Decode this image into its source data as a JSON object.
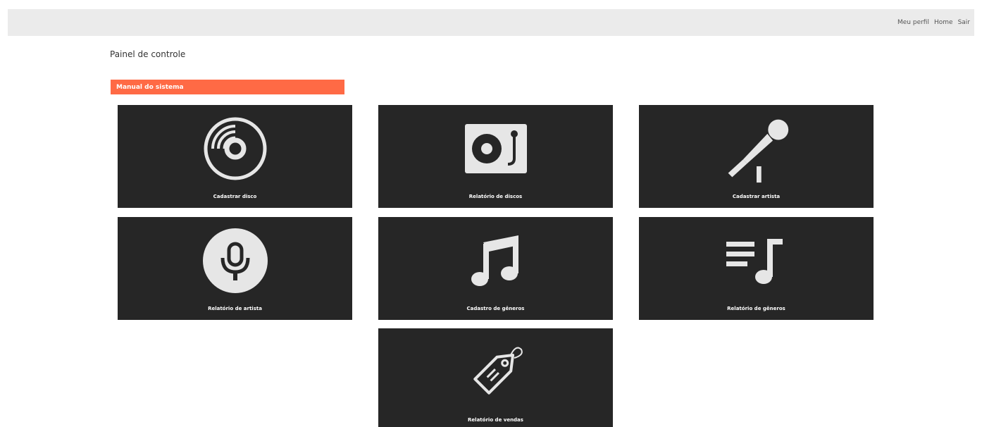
{
  "nav": {
    "items": [
      {
        "label": "Meu perfil"
      },
      {
        "label": "Home"
      },
      {
        "label": "Sair"
      }
    ]
  },
  "page_title": "Painel de controle",
  "manual_label": "Manual do sistema",
  "colors": {
    "accent": "#ff6a45",
    "tile_bg": "#262626",
    "topbar_bg": "#ebebeb",
    "icon": "#e6e6e6"
  },
  "tiles": [
    {
      "label": "Cadastrar disco",
      "icon": "vinyl-disc-icon"
    },
    {
      "label": "Relatório de discos",
      "icon": "turntable-icon"
    },
    {
      "label": "Cadastrar artista",
      "icon": "microphone-icon"
    },
    {
      "label": "Relatório de artista",
      "icon": "podcast-mic-icon"
    },
    {
      "label": "Cadastro de gêneros",
      "icon": "music-note-icon"
    },
    {
      "label": "Relatório de gêneros",
      "icon": "playlist-icon"
    },
    {
      "label": "Relatório de vendas",
      "icon": "price-tag-icon"
    }
  ]
}
